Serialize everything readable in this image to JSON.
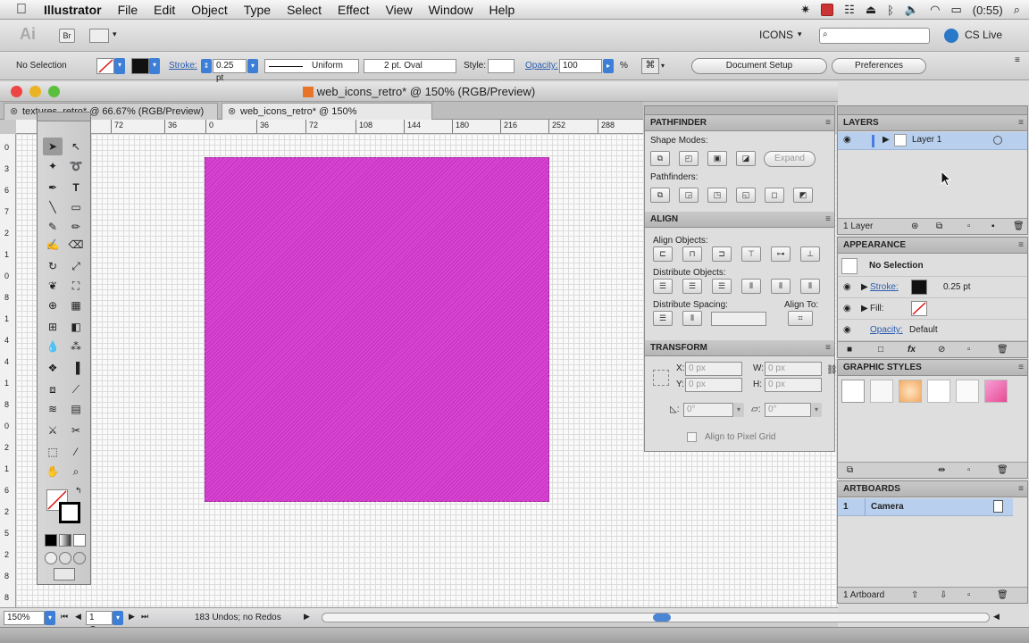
{
  "menubar": {
    "items": [
      "Illustrator",
      "File",
      "Edit",
      "Object",
      "Type",
      "Select",
      "Effect",
      "View",
      "Window",
      "Help"
    ],
    "clock": "(0:55)"
  },
  "appbar": {
    "ai_logo": "Ai",
    "bridge": "Br",
    "workspace": "ICONS",
    "search_placeholder": "",
    "cs_live": "CS Live"
  },
  "control": {
    "selection": "No Selection",
    "stroke_label": "Stroke:",
    "stroke_value": "0.25 pt",
    "profile": "Uniform",
    "brush": "2 pt. Oval",
    "style_label": "Style:",
    "opacity_label": "Opacity:",
    "opacity_value": "100",
    "opacity_unit": "%",
    "document_setup": "Document Setup",
    "preferences": "Preferences"
  },
  "document": {
    "title": "web_icons_retro* @ 150% (RGB/Preview)",
    "tabs": [
      {
        "label": "textures_retro* @ 66.67% (RGB/Preview)"
      },
      {
        "label": "web_icons_retro* @ 150% (RGB/Preview)"
      }
    ],
    "ruler_h": [
      "72",
      "36",
      "0",
      "36",
      "72",
      "108",
      "144",
      "180",
      "216",
      "252",
      "288"
    ],
    "ruler_v": [
      "0",
      "3",
      "6",
      "7",
      "2",
      "1",
      "0",
      "8",
      "1",
      "4",
      "4",
      "1",
      "8",
      "0",
      "2",
      "1",
      "6",
      "2",
      "5",
      "2",
      "8",
      "8"
    ],
    "artboard_color": "#d745d1",
    "zoom": "150%",
    "page": "1 Cam",
    "undo_status": "183 Undos; no Redos"
  },
  "pathfinder": {
    "title": "PATHFINDER",
    "shape_modes": "Shape Modes:",
    "expand": "Expand",
    "pathfinders": "Pathfinders:"
  },
  "align": {
    "title": "ALIGN",
    "align_objects": "Align Objects:",
    "distribute_objects": "Distribute Objects:",
    "distribute_spacing": "Distribute Spacing:",
    "align_to": "Align To:"
  },
  "transform": {
    "title": "TRANSFORM",
    "x_label": "X:",
    "x_value": "0 px",
    "y_label": "Y:",
    "y_value": "0 px",
    "w_label": "W:",
    "w_value": "0 px",
    "h_label": "H:",
    "h_value": "0 px",
    "angle": "0°",
    "shear": "0°",
    "pixel_grid": "Align to Pixel Grid"
  },
  "layers": {
    "title": "LAYERS",
    "layer_name": "Layer 1",
    "footer": "1 Layer"
  },
  "appearance": {
    "title": "APPEARANCE",
    "header": "No Selection",
    "stroke_label": "Stroke:",
    "stroke_value": "0.25 pt",
    "fill_label": "Fill:",
    "opacity_label": "Opacity:",
    "opacity_value": "Default"
  },
  "graphic_styles": {
    "title": "GRAPHIC STYLES"
  },
  "artboards": {
    "title": "ARTBOARDS",
    "number": "1",
    "name": "Camera",
    "footer": "1 Artboard"
  }
}
